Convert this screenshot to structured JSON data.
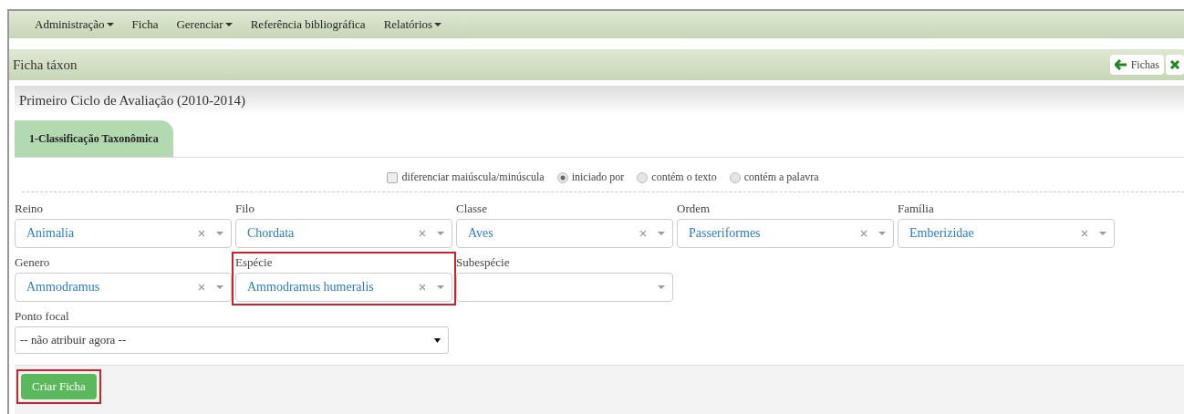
{
  "menu": [
    {
      "label": "Administração",
      "dropdown": true
    },
    {
      "label": "Ficha",
      "dropdown": false
    },
    {
      "label": "Gerenciar",
      "dropdown": true
    },
    {
      "label": "Referência bibliográfica",
      "dropdown": false
    },
    {
      "label": "Relatórios",
      "dropdown": true
    }
  ],
  "page_title": "Ficha táxon",
  "header_buttons": [
    {
      "kind": "back",
      "label": "Fichas"
    },
    {
      "kind": "close"
    }
  ],
  "panel_title": "Primeiro Ciclo de Avaliação (2010-2014)",
  "tabs": [
    {
      "label": "1-Classificação Taxonômica",
      "selected": true
    }
  ],
  "search_options": [
    {
      "kind": "checkbox",
      "label": "diferenciar maiúscula/minúscula",
      "checked": false
    },
    {
      "kind": "radio",
      "label": "iniciado por",
      "selected": true
    },
    {
      "kind": "radio",
      "label": "contém o texto",
      "selected": false
    },
    {
      "kind": "radio",
      "label": "contém a palavra",
      "selected": false
    }
  ],
  "field_rows": [
    [
      {
        "label": "Reino",
        "value": "Animalia",
        "highlighted": false
      },
      {
        "label": "Filo",
        "value": "Chordata",
        "highlighted": false
      },
      {
        "label": "Classe",
        "value": "Aves",
        "highlighted": false
      },
      {
        "label": "Ordem",
        "value": "Passeriformes",
        "highlighted": false
      },
      {
        "label": "Família",
        "value": "Emberizidae",
        "highlighted": false
      }
    ],
    [
      {
        "label": "Genero",
        "value": "Ammodramus",
        "highlighted": false
      },
      {
        "label": "Espécie",
        "value": "Ammodramus humeralis",
        "highlighted": true
      },
      {
        "label": "Subespécie",
        "highlighted": false
      }
    ]
  ],
  "focal_point": {
    "label": "Ponto focal",
    "value": "-- não atribuir agora --"
  },
  "submit": {
    "label": "Criar Ficha",
    "highlighted": true
  }
}
